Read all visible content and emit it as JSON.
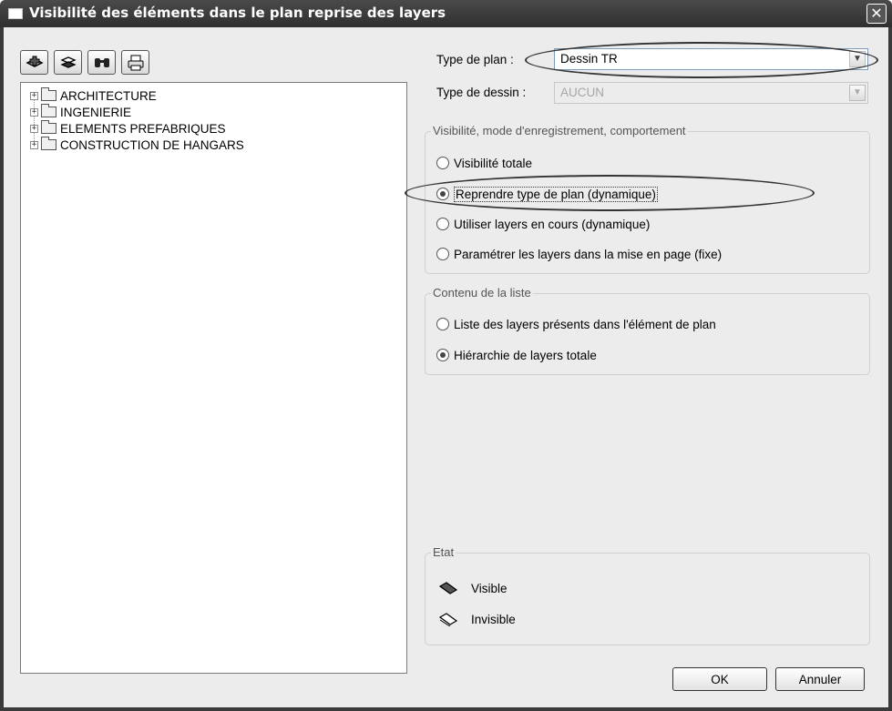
{
  "window": {
    "title": "Visibilité des éléments dans le plan reprise des layers",
    "close_glyph": "✕"
  },
  "toolbar": {
    "icons": [
      "layer-add-icon",
      "layer-list-icon",
      "binoculars-icon",
      "printer-icon"
    ]
  },
  "tree": {
    "items": [
      {
        "label": "ARCHITECTURE",
        "expander": "+"
      },
      {
        "label": "INGENIERIE",
        "expander": "+"
      },
      {
        "label": "ELEMENTS PREFABRIQUES",
        "expander": "+"
      },
      {
        "label": "CONSTRUCTION DE HANGARS",
        "expander": "+"
      }
    ]
  },
  "form": {
    "type_plan_label": "Type de plan :",
    "type_plan_value": "Dessin TR",
    "type_dessin_label": "Type de dessin :",
    "type_dessin_value": "AUCUN"
  },
  "visibility_group": {
    "title": "Visibilité, mode d'enregistrement, comportement",
    "options": [
      {
        "label": "Visibilité totale",
        "checked": false
      },
      {
        "label": "Reprendre type de plan (dynamique)",
        "checked": true
      },
      {
        "label": "Utiliser layers en cours (dynamique)",
        "checked": false
      },
      {
        "label": "Paramétrer les layers dans la mise en page (fixe)",
        "checked": false
      }
    ]
  },
  "list_group": {
    "title": "Contenu de la liste",
    "options": [
      {
        "label": "Liste des layers présents dans l'élément de plan",
        "checked": false
      },
      {
        "label": "Hiérarchie de layers totale",
        "checked": true
      }
    ]
  },
  "state_group": {
    "title": "Etat",
    "items": [
      {
        "label": "Visible",
        "icon": "layer-visible-icon"
      },
      {
        "label": "Invisible",
        "icon": "layer-invisible-icon"
      }
    ]
  },
  "buttons": {
    "ok": "OK",
    "cancel": "Annuler"
  }
}
